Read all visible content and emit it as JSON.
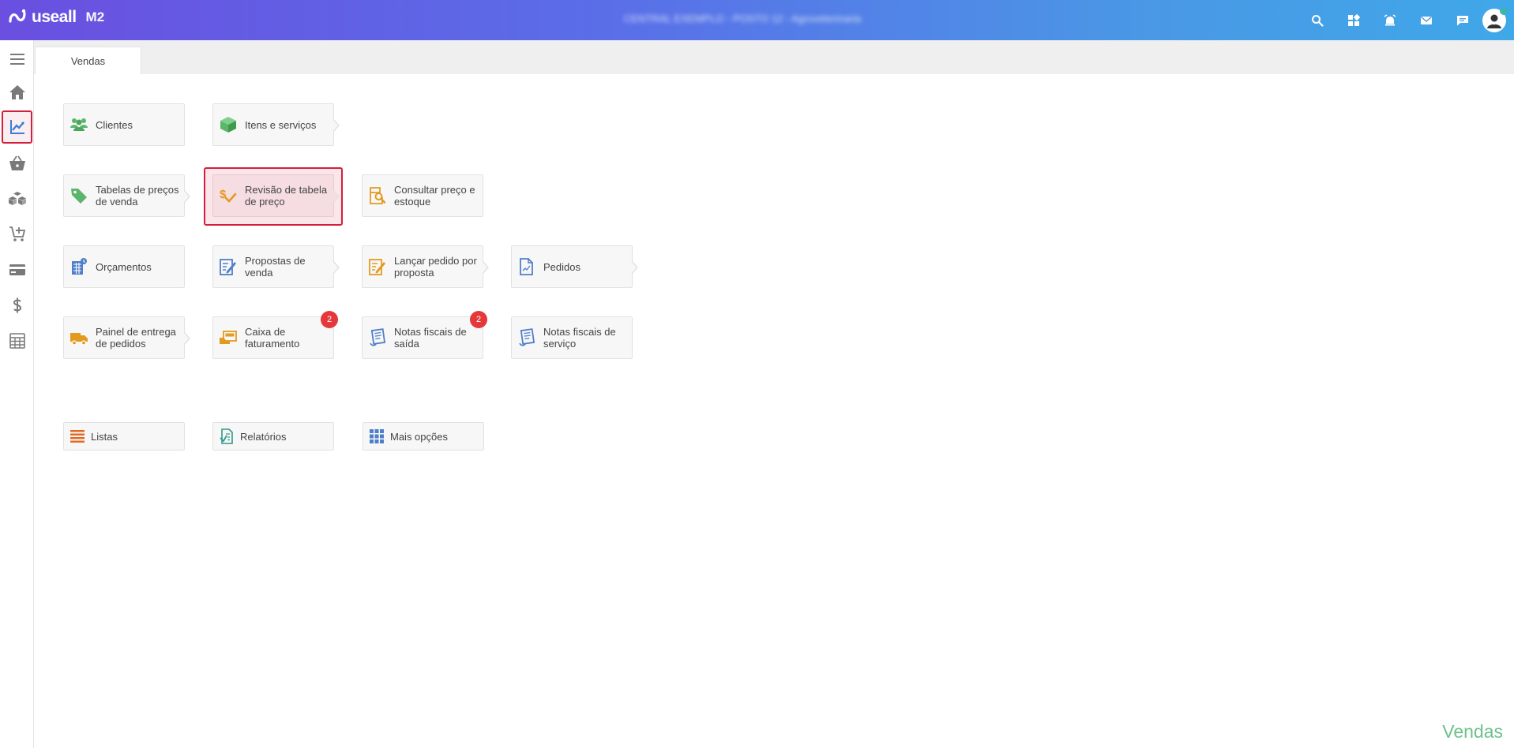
{
  "app": {
    "brand": "useall",
    "version_label": "M2",
    "company_blurred": "CENTRAL EXEMPLO - POSTO 12 - Agroveterinaria"
  },
  "tabs": [
    {
      "label": "Vendas"
    }
  ],
  "tiles": {
    "clientes": "Clientes",
    "itens": "Itens e serviços",
    "tabelas": "Tabelas de preços de venda",
    "revisao": "Revisão de tabela de preço",
    "consultar": "Consultar preço e estoque",
    "orcamentos": "Orçamentos",
    "propostas": "Propostas de venda",
    "lancar": "Lançar pedido por proposta",
    "pedidos": "Pedidos",
    "painel": "Painel de entrega de pedidos",
    "caixa": "Caixa de faturamento",
    "nf_saida": "Notas fiscais de saída",
    "nf_servico": "Notas fiscais de serviço"
  },
  "badges": {
    "caixa": "2",
    "nf_saida": "2"
  },
  "bottom": {
    "listas": "Listas",
    "relatorios": "Relatórios",
    "mais": "Mais opções"
  },
  "page_title": "Vendas",
  "colors": {
    "accent_red": "#d21f3c",
    "title_green": "#6cc28a",
    "badge_red": "#e5383b"
  },
  "icons": {
    "top": [
      "search-icon",
      "apps-icon",
      "alarm-icon",
      "mail-icon",
      "chat-icon",
      "user-avatar"
    ],
    "sidebar": [
      "menu-icon",
      "home-icon",
      "chart-icon",
      "basket-icon",
      "boxes-icon",
      "cart-icon",
      "card-icon",
      "dollar-icon",
      "calculator-icon"
    ]
  }
}
